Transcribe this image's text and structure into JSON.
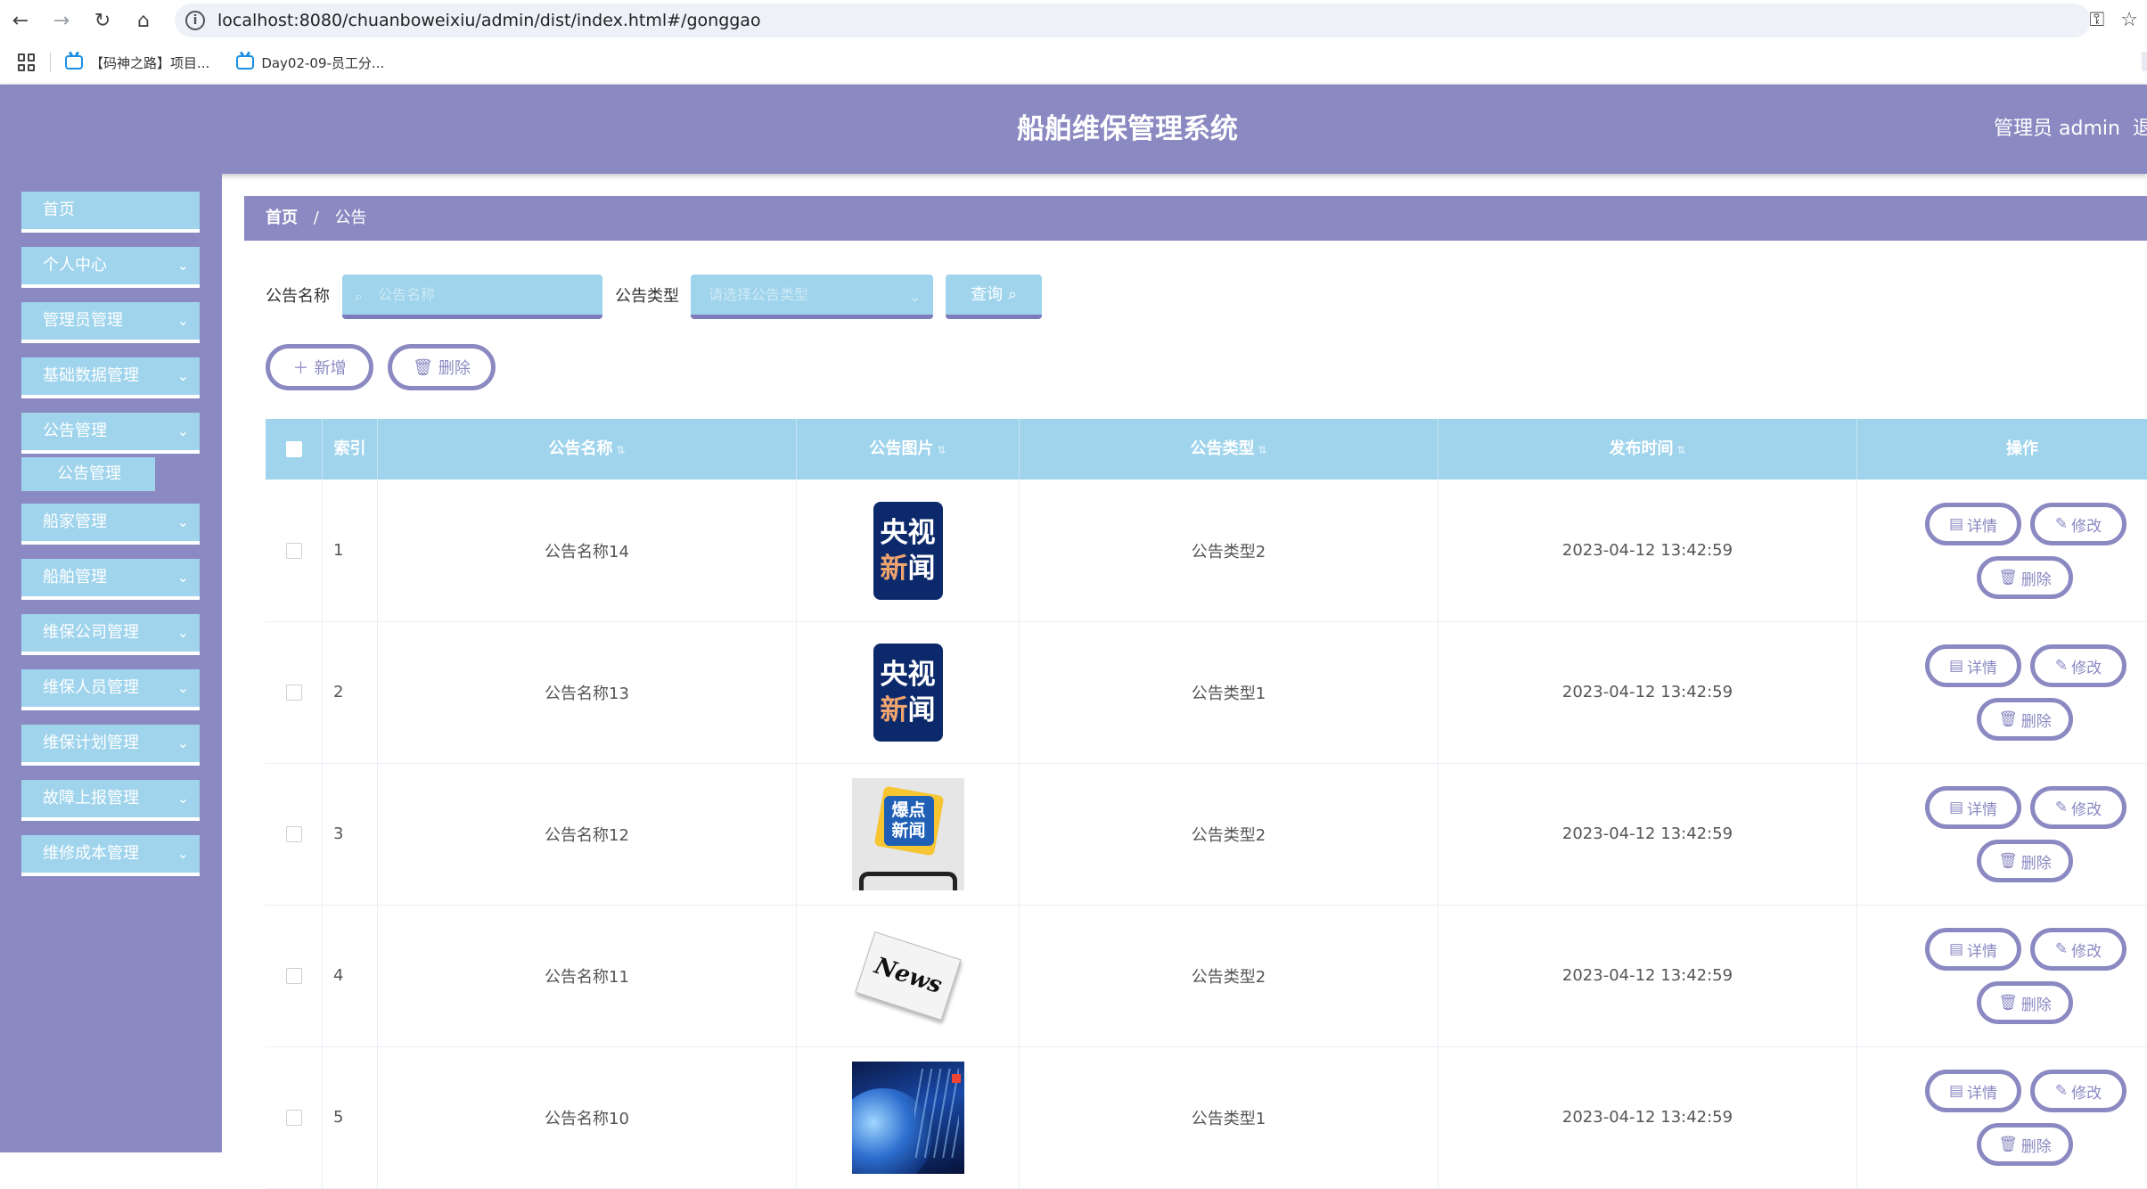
{
  "browser": {
    "url": "localhost:8080/chuanboweixiu/admin/dist/index.html#/gonggao",
    "bookmarks": [
      {
        "label": "【码神之路】项目..."
      },
      {
        "label": "Day02-09-员工分..."
      }
    ]
  },
  "header": {
    "title": "船舶维保管理系统",
    "user": "管理员 admin",
    "logout": "退"
  },
  "sidebar": {
    "items": [
      {
        "label": "首页",
        "has_submenu": false
      },
      {
        "label": "个人中心",
        "has_submenu": true
      },
      {
        "label": "管理员管理",
        "has_submenu": true
      },
      {
        "label": "基础数据管理",
        "has_submenu": true
      },
      {
        "label": "公告管理",
        "has_submenu": true,
        "expanded": true,
        "children": [
          {
            "label": "公告管理"
          }
        ]
      },
      {
        "label": "船家管理",
        "has_submenu": true
      },
      {
        "label": "船舶管理",
        "has_submenu": true
      },
      {
        "label": "维保公司管理",
        "has_submenu": true
      },
      {
        "label": "维保人员管理",
        "has_submenu": true
      },
      {
        "label": "维保计划管理",
        "has_submenu": true
      },
      {
        "label": "故障上报管理",
        "has_submenu": true
      },
      {
        "label": "维修成本管理",
        "has_submenu": true
      }
    ]
  },
  "breadcrumb": {
    "home": "首页",
    "separator": "/",
    "current": "公告"
  },
  "search": {
    "name_label": "公告名称",
    "name_placeholder": "公告名称",
    "type_label": "公告类型",
    "type_placeholder": "请选择公告类型",
    "query_label": "查询"
  },
  "actions": {
    "add_label": "新增",
    "delete_label": "删除"
  },
  "table": {
    "columns": {
      "index": "索引",
      "name": "公告名称",
      "image": "公告图片",
      "type": "公告类型",
      "time": "发布时间",
      "ops": "操作"
    },
    "row_actions": {
      "detail": "详情",
      "edit": "修改",
      "delete": "删除"
    },
    "rows": [
      {
        "index": "1",
        "name": "公告名称14",
        "image": "cctv-news",
        "type": "公告类型2",
        "time": "2023-04-12 13:42:59"
      },
      {
        "index": "2",
        "name": "公告名称13",
        "image": "cctv-news",
        "type": "公告类型1",
        "time": "2023-04-12 13:42:59"
      },
      {
        "index": "3",
        "name": "公告名称12",
        "image": "baodian-news",
        "type": "公告类型2",
        "time": "2023-04-12 13:42:59"
      },
      {
        "index": "4",
        "name": "公告名称11",
        "image": "newspaper",
        "type": "公告类型2",
        "time": "2023-04-12 13:42:59"
      },
      {
        "index": "5",
        "name": "公告名称10",
        "image": "globe",
        "type": "公告类型1",
        "time": "2023-04-12 13:42:59"
      }
    ]
  },
  "thumb_text": {
    "cctv_line1": "央视",
    "cctv_line2a": "新",
    "cctv_line2b": "闻",
    "baodian_line1": "爆点",
    "baodian_line2": "新闻",
    "news": "News"
  },
  "colors": {
    "theme": "#8b89c2",
    "accent": "#9fd4ec"
  }
}
